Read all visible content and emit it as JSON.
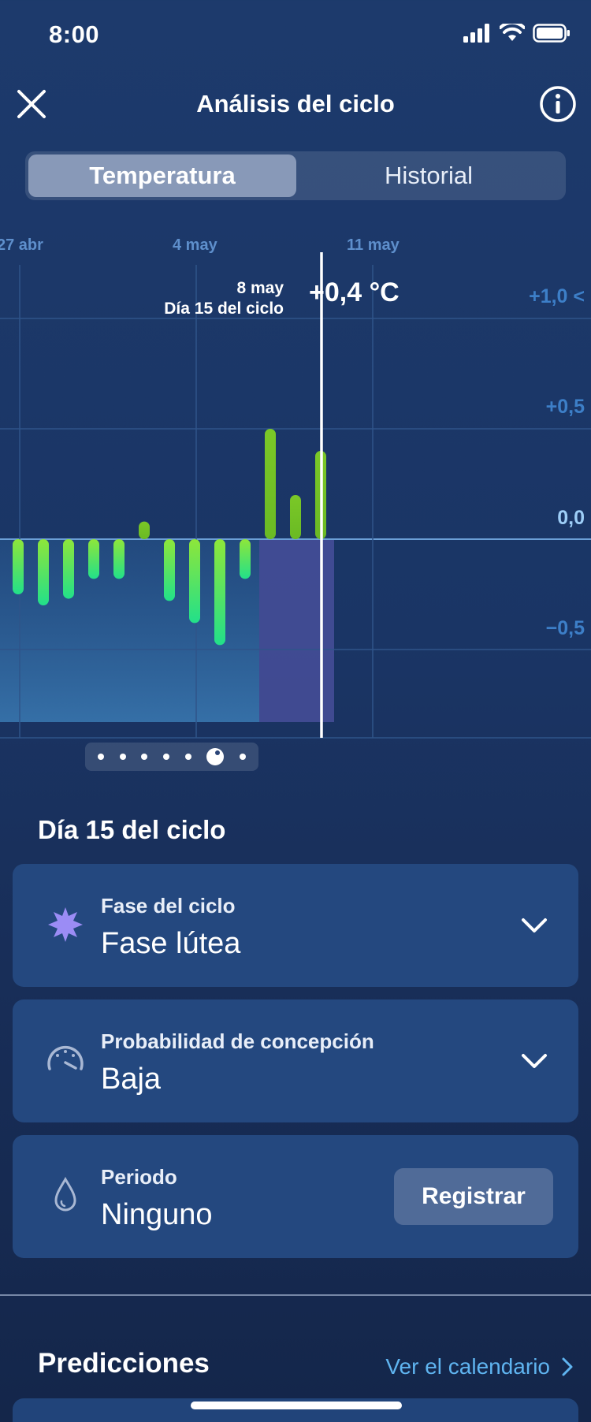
{
  "status_bar": {
    "time": "8:00"
  },
  "header": {
    "title": "Análisis del ciclo"
  },
  "tabs": [
    {
      "label": "Temperatura",
      "active": true
    },
    {
      "label": "Historial",
      "active": false
    }
  ],
  "chart": {
    "date_labels": [
      "27 abr",
      "4 may",
      "11 may"
    ],
    "selected": {
      "date": "8 may",
      "cycle_day": "Día 15 del ciclo",
      "value": "+0,4 °C"
    },
    "y_ticks": [
      "+1,0 <",
      "+0,5",
      "0,0",
      "−0,5"
    ]
  },
  "chart_data": {
    "type": "bar",
    "ylabel": "°C",
    "ylim": [
      -0.9,
      1.1
    ],
    "x_start_day": 1,
    "x": [
      1,
      2,
      3,
      4,
      5,
      6,
      7,
      8,
      9,
      10,
      11,
      12,
      13,
      14,
      15
    ],
    "values": [
      -0.25,
      -0.3,
      -0.27,
      -0.18,
      -0.18,
      0.08,
      -0.28,
      -0.38,
      -0.48,
      -0.18,
      0.5,
      0.2,
      0.4
    ],
    "bar_days": [
      3,
      4,
      5,
      6,
      7,
      8,
      9,
      10,
      11,
      12,
      13,
      14,
      15
    ],
    "selected_day": 15,
    "selected_value": 0.4
  },
  "pager": {
    "count": 7,
    "active_index": 5
  },
  "cycle_day_section": {
    "title": "Día 15 del ciclo"
  },
  "cards": [
    {
      "label": "Fase del ciclo",
      "value": "Fase lútea",
      "icon": "star-burst-icon"
    },
    {
      "label": "Probabilidad de concepción",
      "value": "Baja",
      "icon": "gauge-icon"
    },
    {
      "label": "Periodo",
      "value": "Ninguno",
      "icon": "drop-icon",
      "action": "Registrar"
    }
  ],
  "predictions": {
    "title": "Predicciones",
    "link": "Ver el calendario"
  },
  "colors": {
    "accent_link": "#5fb4f0",
    "bar_green": "#7bd22a",
    "bar_teal": "#22e08a",
    "selection": "#5a5ab0"
  }
}
